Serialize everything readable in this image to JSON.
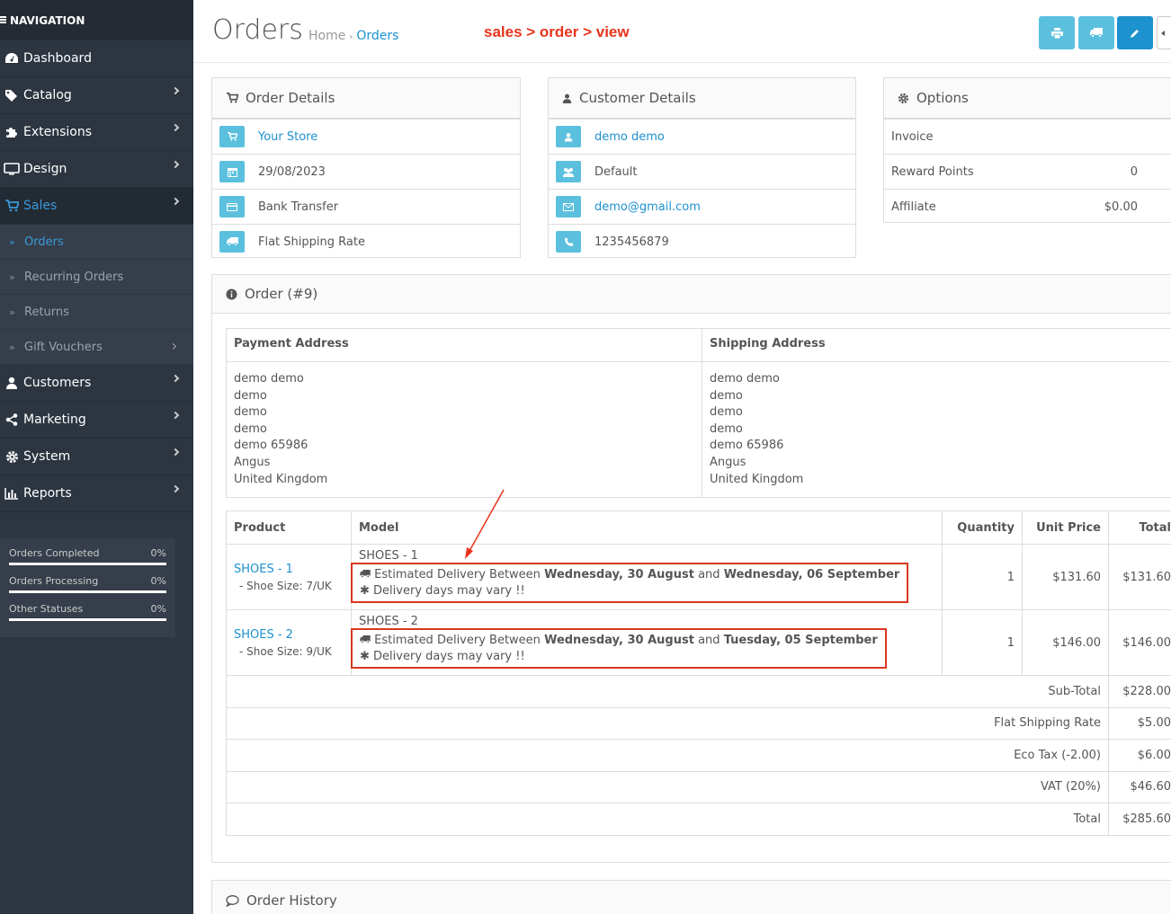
{
  "nav": {
    "heading": "NAVIGATION",
    "items": [
      {
        "label": "Dashboard",
        "icon": "dashboard-icon"
      },
      {
        "label": "Catalog",
        "icon": "tags-icon"
      },
      {
        "label": "Extensions",
        "icon": "puzzle-icon"
      },
      {
        "label": "Design",
        "icon": "desktop-icon"
      },
      {
        "label": "Sales",
        "icon": "cart-icon"
      }
    ],
    "sales_sub": [
      "Orders",
      "Recurring Orders",
      "Returns",
      "Gift Vouchers"
    ],
    "items2": [
      {
        "label": "Customers",
        "icon": "user-icon"
      },
      {
        "label": "Marketing",
        "icon": "share-icon"
      },
      {
        "label": "System",
        "icon": "cog-icon"
      },
      {
        "label": "Reports",
        "icon": "bar-chart-icon"
      }
    ],
    "stats": [
      {
        "label": "Orders Completed",
        "value": "0%"
      },
      {
        "label": "Orders Processing",
        "value": "0%"
      },
      {
        "label": "Other Statuses",
        "value": "0%"
      }
    ]
  },
  "header": {
    "title": "Orders",
    "breadcrumb": [
      "Home",
      "Orders"
    ],
    "annotation": "sales > order > view"
  },
  "order_details": {
    "title": "Order Details",
    "store": "Your Store",
    "date": "29/08/2023",
    "payment": "Bank Transfer",
    "shipping": "Flat Shipping Rate"
  },
  "customer_details": {
    "title": "Customer Details",
    "name": "demo demo",
    "group": "Default",
    "email": "demo@gmail.com",
    "phone": "1235456879"
  },
  "options": {
    "title": "Options",
    "invoice": "Invoice",
    "reward_label": "Reward Points",
    "reward_value": "0",
    "affiliate_label": "Affiliate",
    "affiliate_value": "$0.00"
  },
  "order": {
    "title": "Order (#9)",
    "payment_header": "Payment Address",
    "shipping_header": "Shipping Address",
    "payment_lines": [
      "demo demo",
      "demo",
      "demo",
      "demo",
      "demo 65986",
      "Angus",
      "United Kingdom"
    ],
    "shipping_lines": [
      "demo demo",
      "demo",
      "demo",
      "demo",
      "demo 65986",
      "Angus",
      "United Kingdom"
    ],
    "columns": [
      "Product",
      "Model",
      "Quantity",
      "Unit Price",
      "Total"
    ],
    "products": [
      {
        "name": "SHOES - 1",
        "option": "- Shoe Size: 7/UK",
        "model": "SHOES - 1",
        "est_prefix": "Estimated Delivery Between",
        "date_from": "Wednesday, 30 August",
        "and": "and",
        "date_to": "Wednesday, 06 September",
        "note": "Delivery days may vary !!",
        "qty": "1",
        "price": "$131.60",
        "total": "$131.60"
      },
      {
        "name": "SHOES - 2",
        "option": "- Shoe Size: 9/UK",
        "model": "SHOES - 2",
        "est_prefix": "Estimated Delivery Between",
        "date_from": "Wednesday, 30 August",
        "and": "and",
        "date_to": "Tuesday, 05 September",
        "note": "Delivery days may vary !!",
        "qty": "1",
        "price": "$146.00",
        "total": "$146.00"
      }
    ],
    "totals": [
      {
        "label": "Sub-Total",
        "value": "$228.00"
      },
      {
        "label": "Flat Shipping Rate",
        "value": "$5.00"
      },
      {
        "label": "Eco Tax (-2.00)",
        "value": "$6.00"
      },
      {
        "label": "VAT (20%)",
        "value": "$46.60"
      },
      {
        "label": "Total",
        "value": "$285.60"
      }
    ]
  },
  "history": {
    "title": "Order History"
  },
  "colors": {
    "sidebar": "#2d3540",
    "accent": "#1e91cf",
    "info": "#5bc0de",
    "annotation": "#e8341c"
  }
}
